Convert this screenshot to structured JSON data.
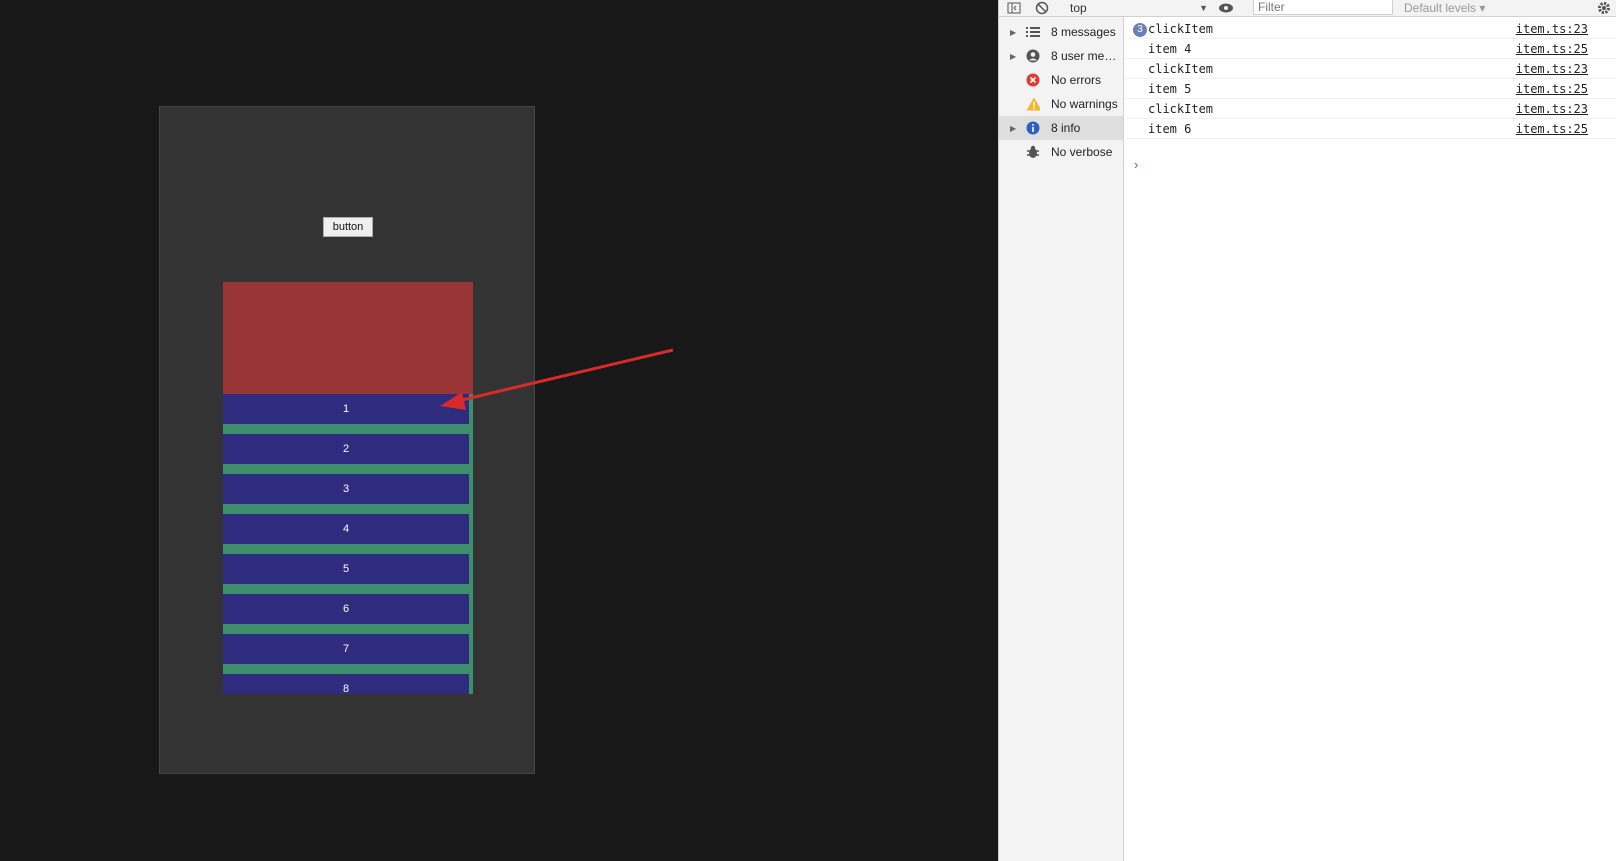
{
  "app": {
    "button_label": "button",
    "list_items": [
      "1",
      "2",
      "3",
      "4",
      "5",
      "6",
      "7",
      "8"
    ]
  },
  "devtools": {
    "toolbar": {
      "context": "top",
      "filter_placeholder": "Filter",
      "levels_label": "Default levels ▾"
    },
    "sidebar": [
      {
        "label": "8 messages",
        "icon": "list-icon",
        "expandable": true
      },
      {
        "label": "8 user mes…",
        "icon": "user-icon",
        "expandable": true
      },
      {
        "label": "No errors",
        "icon": "error-icon",
        "expandable": false
      },
      {
        "label": "No warnings",
        "icon": "warning-icon",
        "expandable": false
      },
      {
        "label": "8 info",
        "icon": "info-icon",
        "expandable": true,
        "selected": true
      },
      {
        "label": "No verbose",
        "icon": "bug-icon",
        "expandable": false
      }
    ],
    "console": {
      "repeat_count": "3",
      "rows": [
        {
          "message": "clickItem",
          "source": "item.ts:23"
        },
        {
          "message": "item 4",
          "source": "item.ts:25"
        },
        {
          "message": "clickItem",
          "source": "item.ts:23"
        },
        {
          "message": "item 5",
          "source": "item.ts:25"
        },
        {
          "message": "clickItem",
          "source": "item.ts:23"
        },
        {
          "message": "item 6",
          "source": "item.ts:25"
        }
      ],
      "prompt": "›"
    }
  },
  "colors": {
    "page_bg": "#181818",
    "frame_bg": "#333333",
    "header_red": "#993537",
    "item_blue": "#2f2b7e",
    "gap_green": "#3d8e6b",
    "arrow_red": "#d92a2a"
  }
}
